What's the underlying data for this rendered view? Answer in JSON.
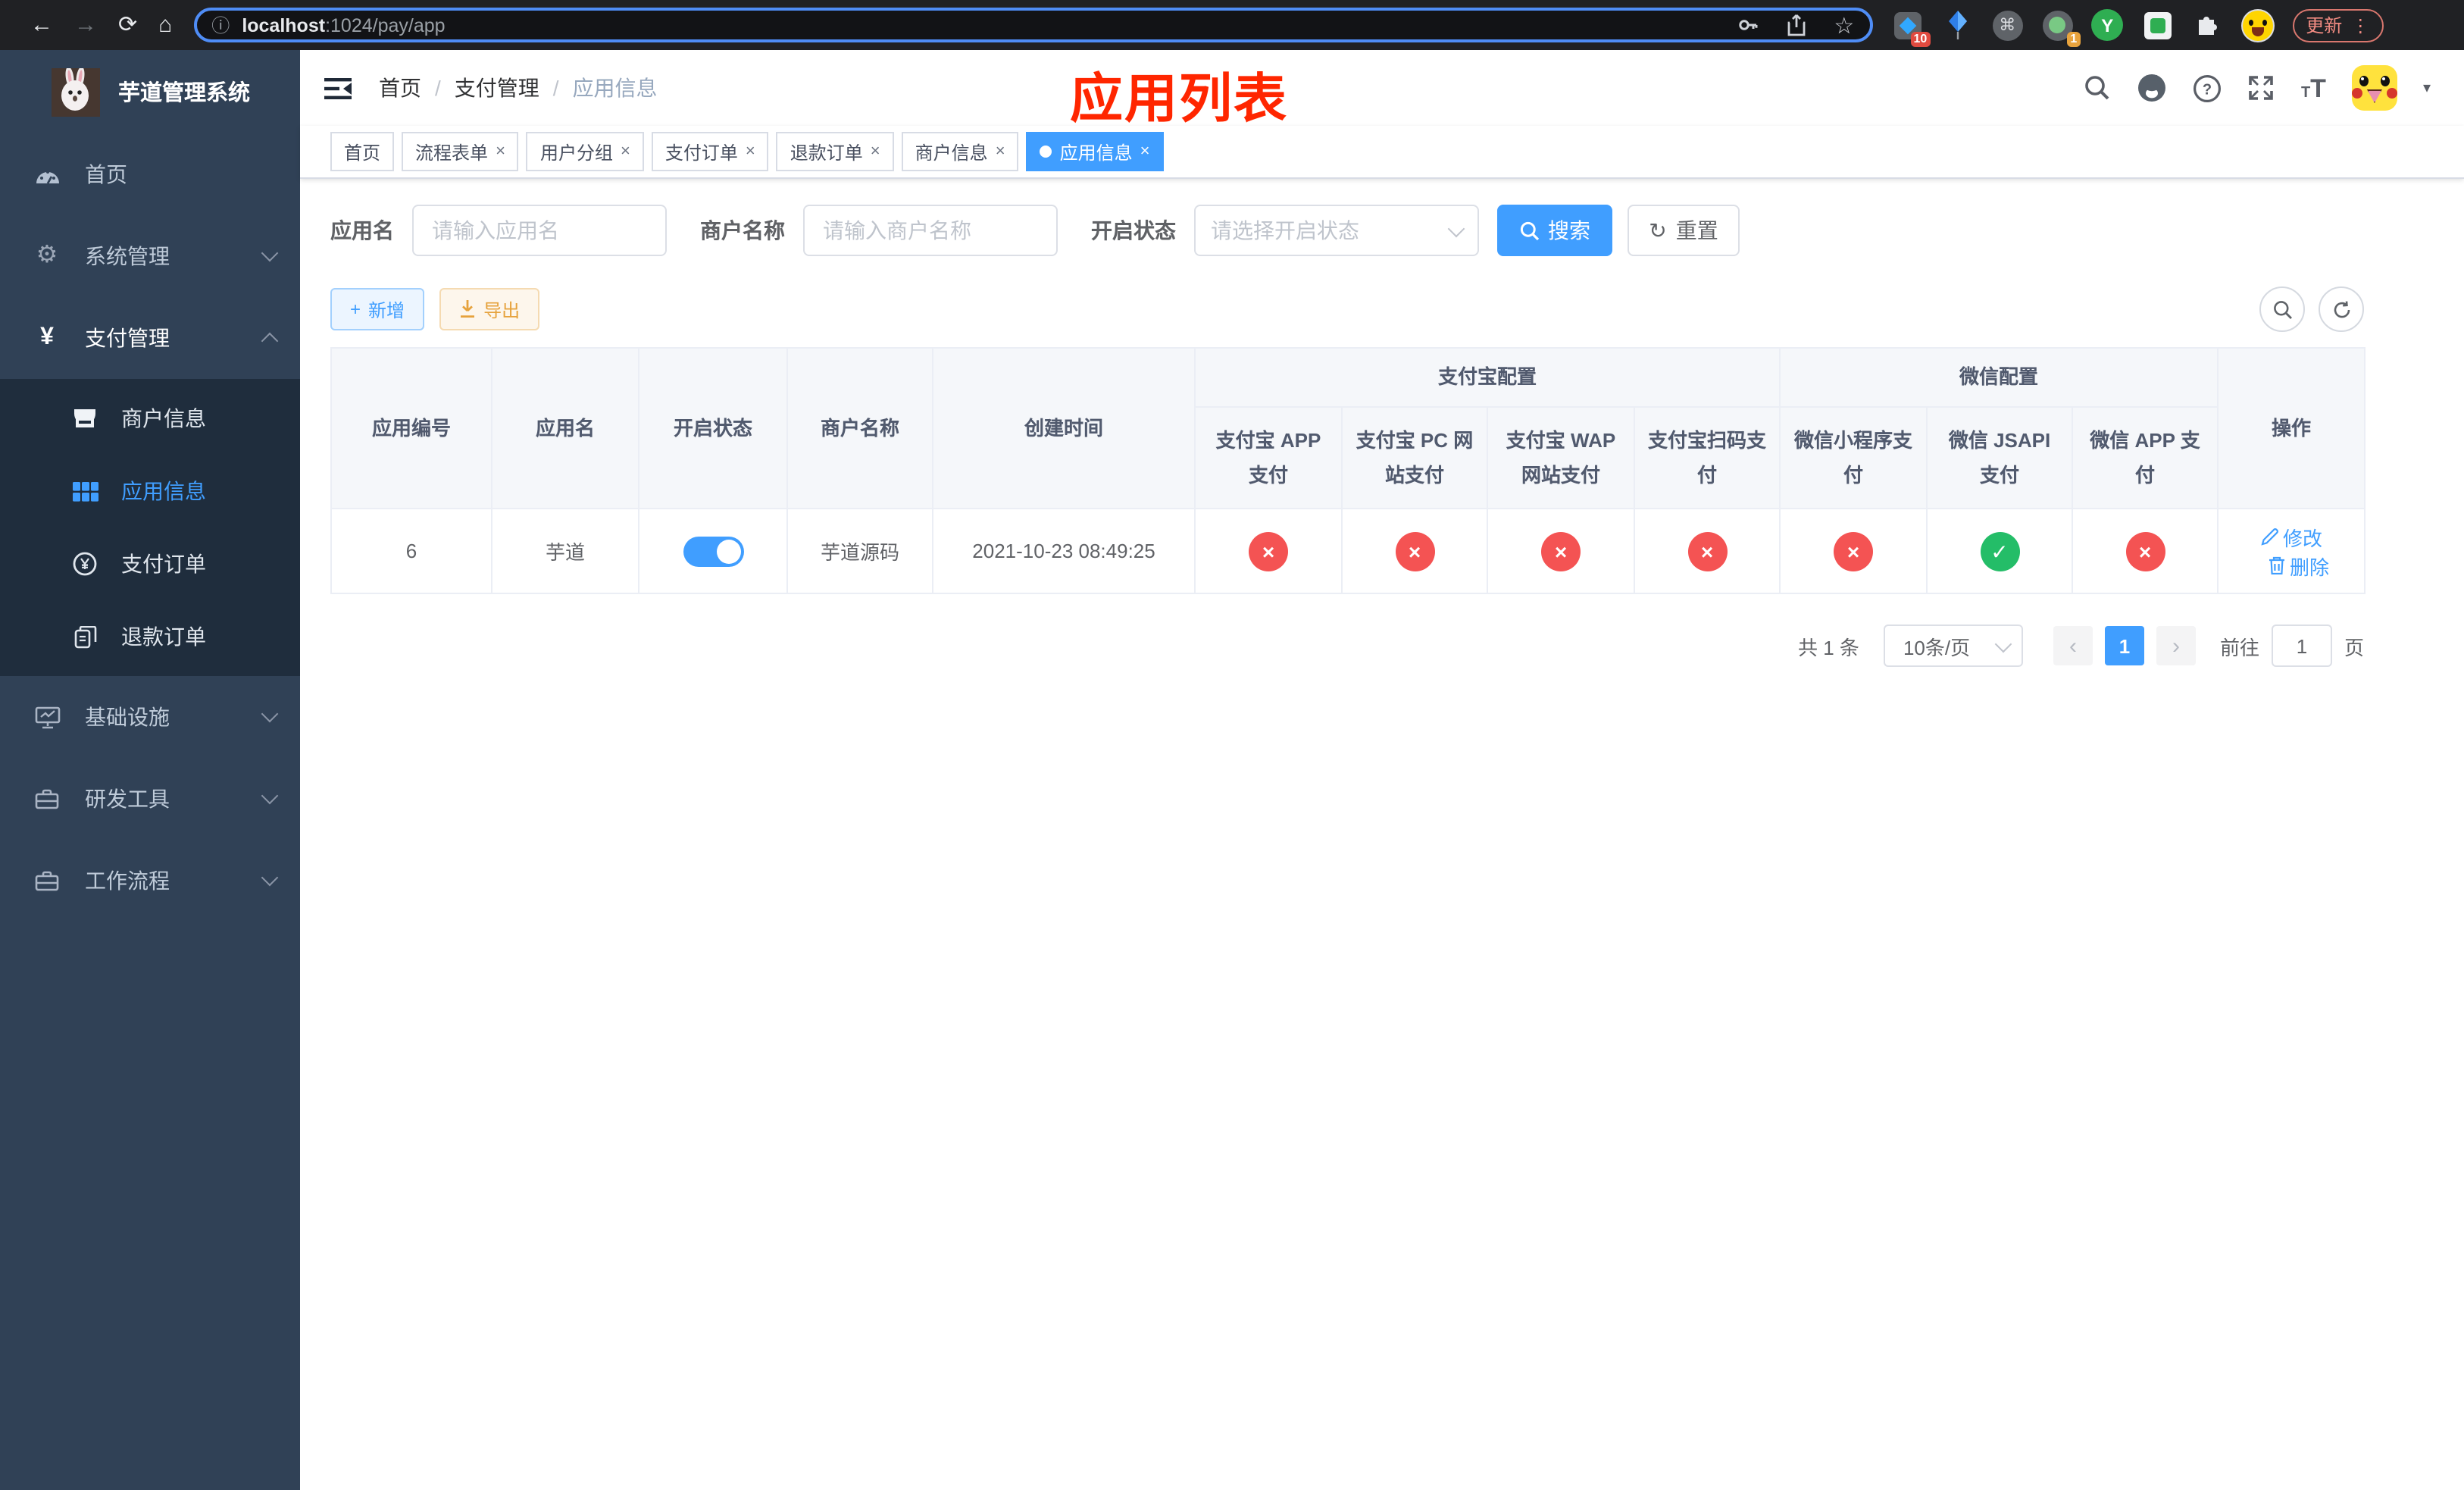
{
  "colors": {
    "accent": "#409eff",
    "success": "#24bd68",
    "danger": "#f45353",
    "warning": "#e6a23c",
    "annotation": "#ff2600",
    "sidebar_bg": "#304156",
    "submenu_bg": "#1f2d3d"
  },
  "icons": {
    "back": "←",
    "forward": "→",
    "reload": "⟳",
    "home": "⌂",
    "info": "ⓘ",
    "star": "☆",
    "command": "⌘",
    "kebab": "⋮",
    "caret_down": "▾",
    "check": "✓",
    "cross": "×",
    "prev": "‹",
    "next": "›",
    "plus": "+",
    "refresh": "↻"
  },
  "browser": {
    "url_host": "localhost",
    "url_rest": ":1024/pay/app",
    "update_label": "更新",
    "extension_badge_1": "10",
    "extension_badge_2": "1",
    "y_extension_letter": "Y"
  },
  "annotation": {
    "text": "应用列表"
  },
  "sidebar": {
    "title": "芋道管理系统",
    "items": [
      {
        "label": "首页"
      },
      {
        "label": "系统管理"
      },
      {
        "label": "支付管理"
      },
      {
        "label": "商户信息"
      },
      {
        "label": "应用信息"
      },
      {
        "label": "支付订单"
      },
      {
        "label": "退款订单"
      },
      {
        "label": "基础设施"
      },
      {
        "label": "研发工具"
      },
      {
        "label": "工作流程"
      }
    ]
  },
  "breadcrumb": {
    "separator": "/",
    "items": [
      "首页",
      "支付管理",
      "应用信息"
    ]
  },
  "tabs": [
    {
      "label": "首页"
    },
    {
      "label": "流程表单"
    },
    {
      "label": "用户分组"
    },
    {
      "label": "支付订单"
    },
    {
      "label": "退款订单"
    },
    {
      "label": "商户信息"
    },
    {
      "label": "应用信息"
    }
  ],
  "filters": {
    "app_name_label": "应用名",
    "app_name_placeholder": "请输入应用名",
    "merchant_label": "商户名称",
    "merchant_placeholder": "请输入商户名称",
    "status_label": "开启状态",
    "status_placeholder": "请选择开启状态",
    "search_label": "搜索",
    "reset_label": "重置"
  },
  "toolbar": {
    "add_label": "新增",
    "export_label": "导出"
  },
  "table": {
    "group_alipay": "支付宝配置",
    "group_wechat": "微信配置",
    "headers": [
      "应用编号",
      "应用名",
      "开启状态",
      "商户名称",
      "创建时间"
    ],
    "pay_headers": [
      "支付宝 APP 支付",
      "支付宝 PC 网站支付",
      "支付宝 WAP 网站支付",
      "支付宝扫码支付",
      "微信小程序支付",
      "微信 JSAPI 支付",
      "微信 APP 支付"
    ],
    "action_header": "操作",
    "row": {
      "id": "6",
      "name": "芋道",
      "enabled": true,
      "merchant": "芋道源码",
      "created_at": "2021-10-23 08:49:25",
      "statuses": [
        "fail",
        "fail",
        "fail",
        "fail",
        "fail",
        "success",
        "fail"
      ],
      "edit_label": "修改",
      "delete_label": "删除"
    }
  },
  "pagination": {
    "total": "共 1 条",
    "page_size": "10条/页",
    "current_page": "1",
    "goto_label": "前往",
    "goto_value": "1",
    "page_unit": "页"
  }
}
